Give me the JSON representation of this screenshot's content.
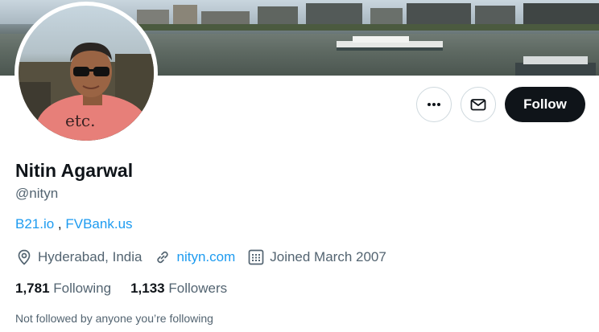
{
  "profile": {
    "name": "Nitin Agarwal",
    "handle": "@nityn",
    "bio": {
      "link1": "B21.io",
      "separator": " , ",
      "link2": "FVBank.us"
    },
    "location": "Hyderabad, India",
    "website": "nityn.com",
    "joined": "Joined March 2007",
    "following_count": "1,781",
    "following_label": "Following",
    "followers_count": "1,133",
    "followers_label": "Followers",
    "not_followed_text": "Not followed by anyone you’re following"
  },
  "actions": {
    "follow_label": "Follow",
    "more_icon": "more-icon",
    "message_icon": "envelope-icon"
  },
  "colors": {
    "link": "#1d9bf0",
    "primary_text": "#0f1419",
    "secondary_text": "#536471",
    "follow_bg": "#0f1419"
  }
}
